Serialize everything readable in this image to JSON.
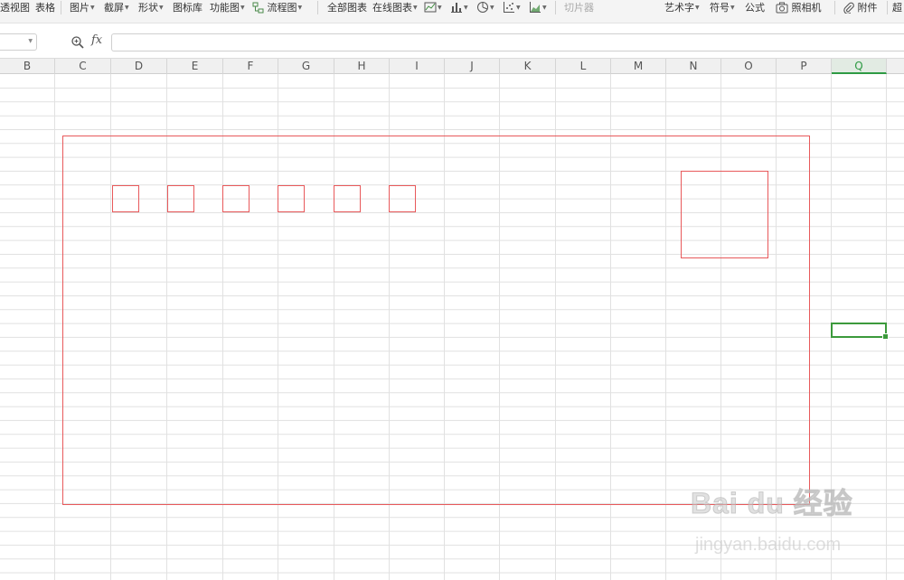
{
  "toolbar": {
    "items": [
      {
        "label": "透视图"
      },
      {
        "label": "表格"
      },
      {
        "label": "图片"
      },
      {
        "label": "截屏"
      },
      {
        "label": "形状"
      },
      {
        "label": "图标库"
      },
      {
        "label": "功能图"
      },
      {
        "label": "流程图"
      },
      {
        "label": "全部图表"
      },
      {
        "label": "在线图表"
      },
      {
        "label": "切片器"
      },
      {
        "label": "艺术字"
      },
      {
        "label": "符号"
      },
      {
        "label": "公式"
      },
      {
        "label": "照相机"
      },
      {
        "label": "附件"
      },
      {
        "label": "超"
      }
    ],
    "chart_icons": [
      "line-chart-icon",
      "bar-chart-icon",
      "pie-chart-icon",
      "scatter-chart-icon",
      "area-chart-icon"
    ]
  },
  "formula_bar": {
    "fx_label": "fx",
    "value": ""
  },
  "columns": [
    "B",
    "C",
    "D",
    "E",
    "F",
    "G",
    "H",
    "I",
    "J",
    "K",
    "L",
    "M",
    "N",
    "O",
    "P",
    "Q"
  ],
  "active_column": "Q",
  "colors": {
    "shape_border": "#e8595b",
    "selection": "#3c9a3c",
    "gridline": "#e1e1e1"
  },
  "watermark": {
    "logo_text": "Bai du 经验",
    "url": "jingyan.baidu.com"
  }
}
